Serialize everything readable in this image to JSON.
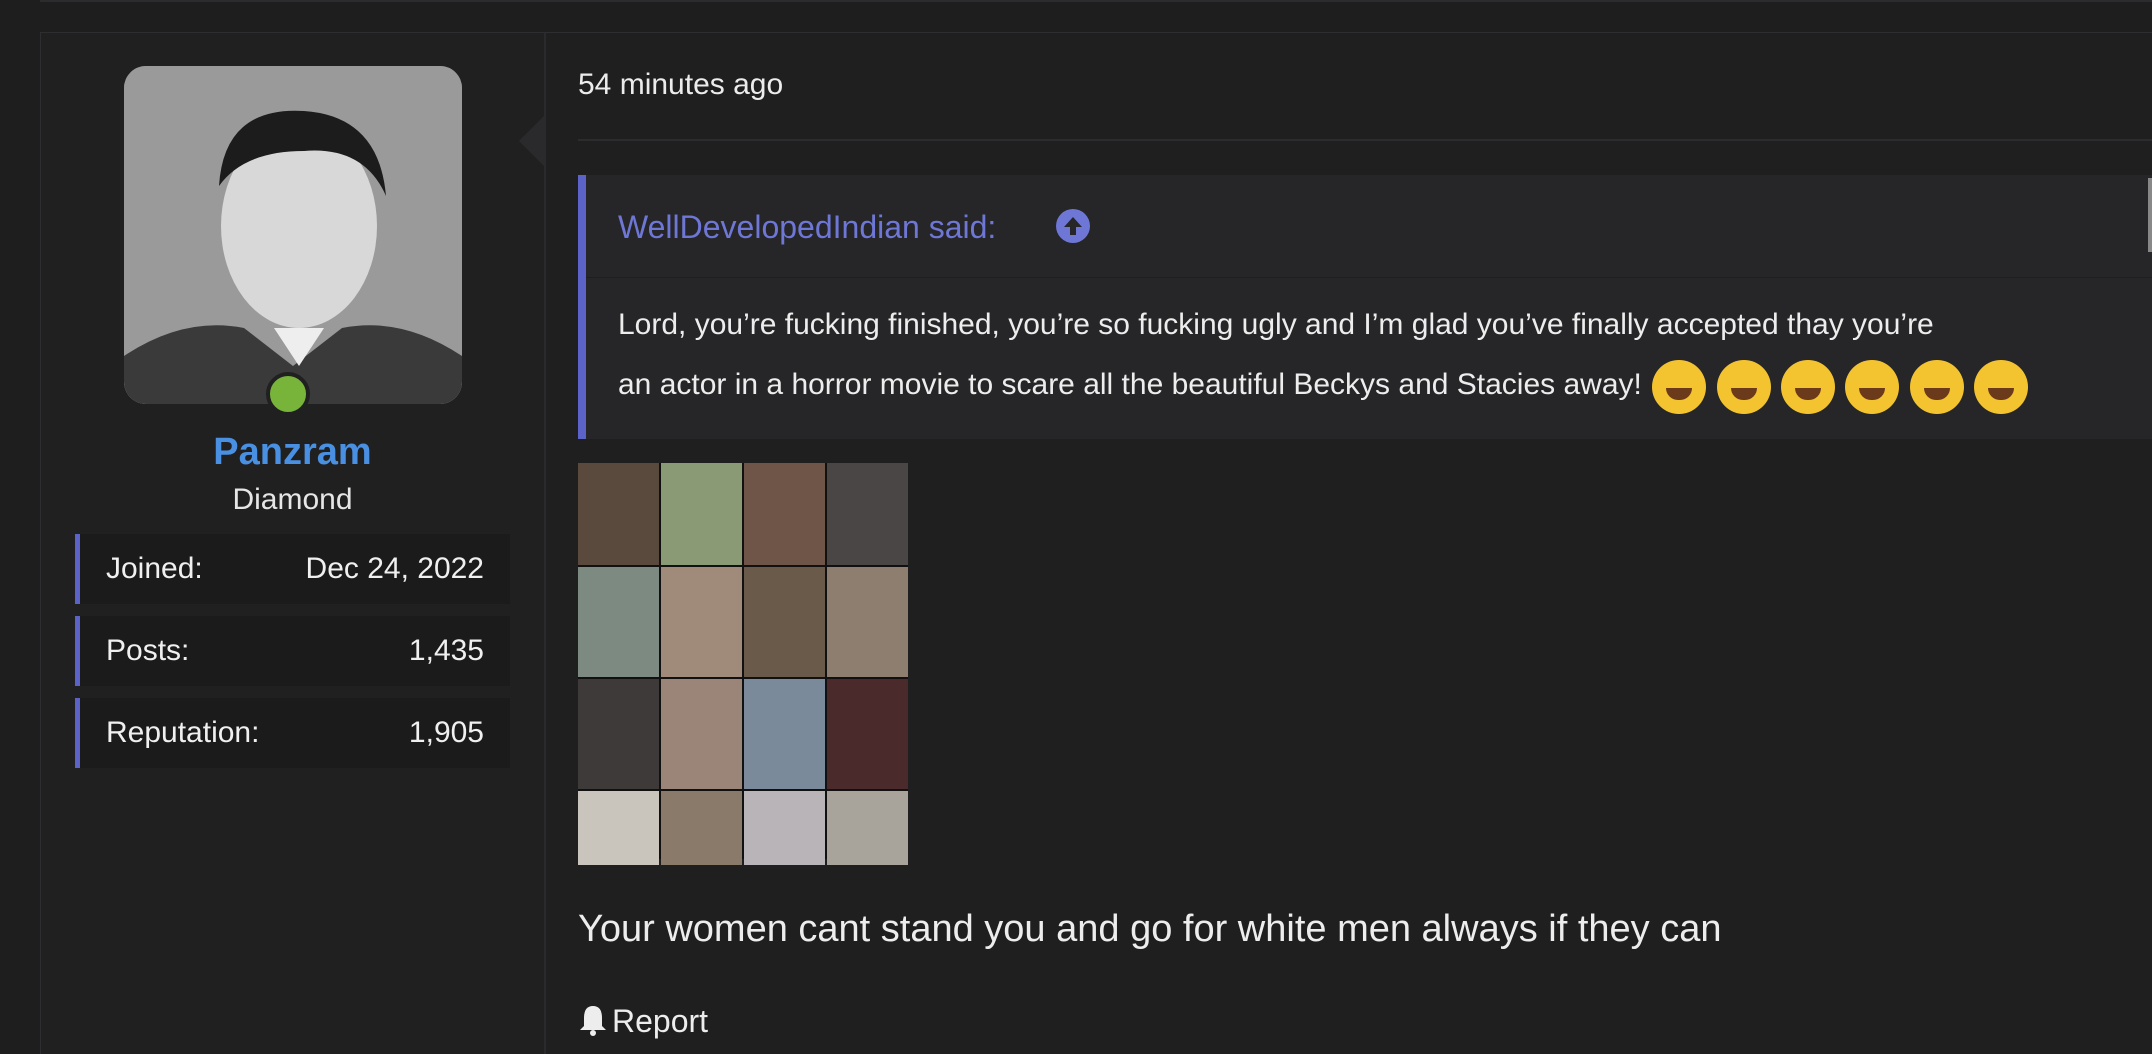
{
  "post": {
    "author": {
      "username": "Panzram",
      "title": "Diamond",
      "online": true,
      "stats": [
        {
          "label": "Joined:",
          "value": "Dec 24, 2022"
        },
        {
          "label": "Posts:",
          "value": "1,435"
        },
        {
          "label": "Reputation:",
          "value": "1,905"
        }
      ]
    },
    "timestamp": "54 minutes ago",
    "quote": {
      "author": "WellDevelopedIndian said:",
      "line1": "Lord, you’re fucking finished, you’re so fucking ugly and I’m glad you’ve finally accepted thay you’re",
      "line2": "an actor in a horror movie to scare all the beautiful Beckys and Stacies away!"
    },
    "body": "Your women cant stand you and go for white men always if they can",
    "report_label": "Report"
  },
  "colors": {
    "background": "#1e1e1f",
    "accent": "#5b63c9",
    "username": "#4a90e2",
    "online": "#78b33a"
  },
  "icons": [
    "arrow-up-circle-icon",
    "bell-icon"
  ]
}
